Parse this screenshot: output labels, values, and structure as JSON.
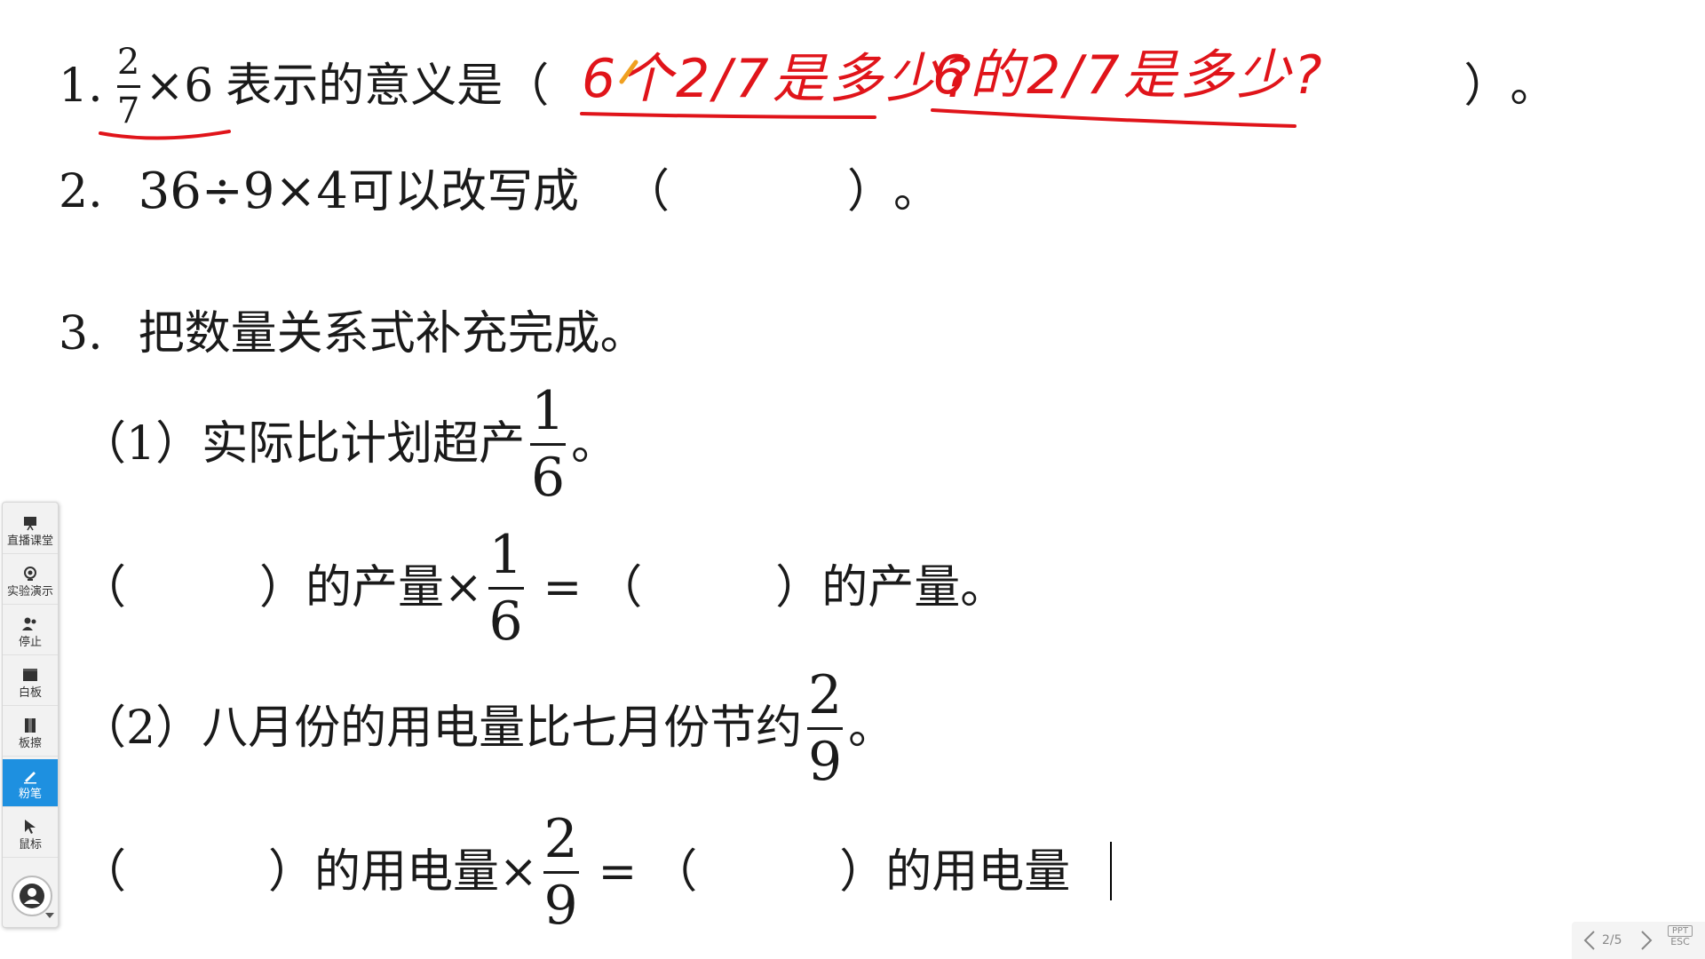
{
  "questions": {
    "q1": {
      "prefix": "1.",
      "frac_num": "2",
      "frac_den": "7",
      "op": "×6",
      "text": "表示的意义是",
      "open": "（",
      "close": "）",
      "end": "。"
    },
    "q2": {
      "prefix": "2.",
      "expr": "36÷9×4",
      "text": "可以改写成",
      "open": "（",
      "close": "）",
      "end": "。"
    },
    "q3": {
      "prefix": "3.",
      "text": "把数量关系式补充完成。",
      "sub1": {
        "label": "（1）",
        "text": "实际比计划超产",
        "frac_num": "1",
        "frac_den": "6",
        "end": "。"
      },
      "eq1": {
        "open1": "（",
        "close1": "）",
        "mid": "的产量×",
        "frac_num": "1",
        "frac_den": "6",
        "eq": "=",
        "open2": "（",
        "close2": "）",
        "tail": "的产量。"
      },
      "sub2": {
        "label": "（2）",
        "text": "八月份的用电量比七月份节约",
        "frac_num": "2",
        "frac_den": "9",
        "end": "。"
      },
      "eq2": {
        "open1": "（",
        "close1": "）",
        "mid": "的用电量×",
        "frac_num": "2",
        "frac_den": "9",
        "eq": "=",
        "open2": "（",
        "close2": "）",
        "tail": "的用电量"
      }
    }
  },
  "handwriting": {
    "answer1": "6个2/7是多少?",
    "answer2": "6的2/7是多少?",
    "color": "#e0141a"
  },
  "toolbar": {
    "items": [
      {
        "label": "直播课堂",
        "icon": "presentation-icon"
      },
      {
        "label": "实验演示",
        "icon": "camera-icon"
      },
      {
        "label": "停止",
        "icon": "users-stop-icon"
      },
      {
        "label": "白板",
        "icon": "whiteboard-icon"
      },
      {
        "label": "板擦",
        "icon": "eraser-icon"
      },
      {
        "label": "粉笔",
        "icon": "pen-icon",
        "active": true
      },
      {
        "label": "鼠标",
        "icon": "cursor-icon"
      }
    ],
    "active_color": "#1e90e0"
  },
  "navigator": {
    "page": "2/5",
    "ppt_label": "PPT",
    "esc_label": "ESC"
  }
}
